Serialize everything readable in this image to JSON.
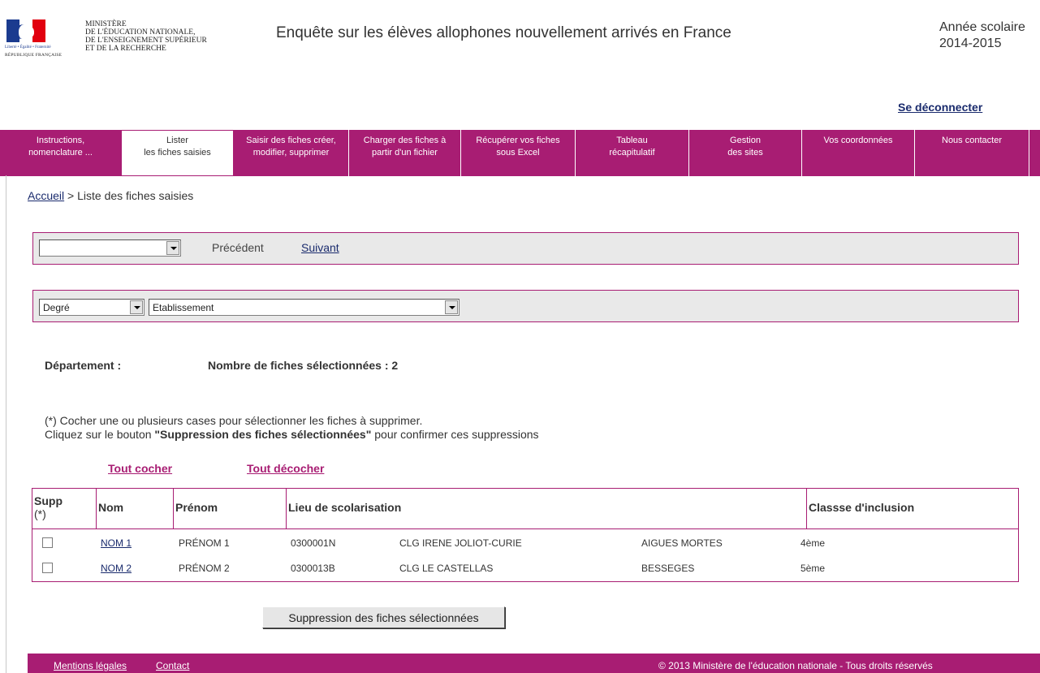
{
  "header": {
    "ministry_lines": [
      "MINISTÈRE",
      "DE L'ÉDUCATION NATIONALE,",
      "DE L'ENSEIGNEMENT SUPÉRIEUR",
      "ET DE LA RECHERCHE"
    ],
    "motto": "Liberté • Égalité • Fraternité",
    "republic": "RÉPUBLIQUE FRANÇAISE",
    "title": "Enquête sur les élèves allophones nouvellement arrivés en France",
    "school_year_label": "Année scolaire",
    "school_year": "2014-2015",
    "logout": "Se déconnecter"
  },
  "nav": [
    {
      "line1": "Instructions,",
      "line2": "nomenclature ..."
    },
    {
      "line1": "Lister",
      "line2": "les fiches saisies"
    },
    {
      "line1": "Saisir des fiches créer,",
      "line2": "modifier, supprimer"
    },
    {
      "line1": "Charger des fiches à",
      "line2": "partir d'un fichier"
    },
    {
      "line1": "Récupérer vos fiches",
      "line2": "sous Excel"
    },
    {
      "line1": "Tableau",
      "line2": "récapitulatif"
    },
    {
      "line1": "Gestion",
      "line2": "des sites"
    },
    {
      "line1": "Vos coordonnées",
      "line2": ""
    },
    {
      "line1": "Nous contacter",
      "line2": ""
    }
  ],
  "breadcrumb": {
    "home": "Accueil",
    "separator": " > ",
    "current": "Liste des fiches saisies"
  },
  "pager": {
    "select_value": "",
    "previous": "Précédent",
    "next": "Suivant"
  },
  "filters": {
    "degree": "Degré",
    "school": "Etablissement"
  },
  "summary": {
    "department": "Département :",
    "count": "Nombre de fiches sélectionnées : 2"
  },
  "instructions": {
    "line1": "(*) Cocher une ou plusieurs cases pour sélectionner les fiches à supprimer.",
    "line2_prefix": "Cliquez sur le bouton ",
    "line2_bold": "\"Suppression des fiches sélectionnées\"",
    "line2_suffix": " pour confirmer ces suppressions"
  },
  "links": {
    "check_all": "Tout cocher",
    "uncheck_all": "Tout décocher"
  },
  "table": {
    "headers": {
      "supp": "Supp",
      "supp2": "(*)",
      "nom": "Nom",
      "prenom": "Prénom",
      "lieu": "Lieu de scolarisation",
      "classe": "Classse d'inclusion"
    },
    "rows": [
      {
        "nom": "NOM 1",
        "prenom": "PRÉNOM 1",
        "code": "0300001N",
        "school": "CLG IRENE JOLIOT-CURIE",
        "city": "AIGUES MORTES",
        "classe": "4ème"
      },
      {
        "nom": "NOM 2",
        "prenom": "PRÉNOM 2",
        "code": "0300013B",
        "school": "CLG LE CASTELLAS",
        "city": "BESSEGES",
        "classe": "5ème"
      }
    ]
  },
  "delete_button": "Suppression des fiches sélectionnées",
  "footer": {
    "legal": "Mentions légales",
    "contact": "Contact",
    "copyright": "© 2013 Ministère de l'éducation nationale - Tous droits réservés"
  }
}
